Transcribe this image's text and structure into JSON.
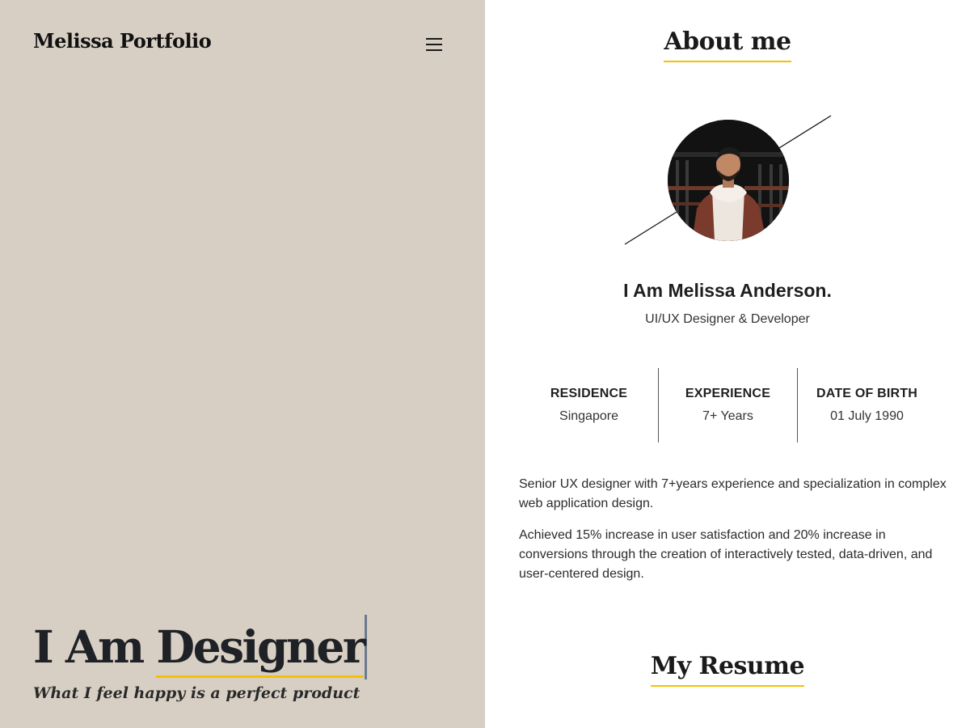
{
  "header": {
    "brand": "Melissa Portfolio",
    "menu_icon": "hamburger-menu-icon"
  },
  "hero": {
    "title_prefix": "I Am ",
    "title_typed": "Designer",
    "subtitle": "What I feel happy is a perfect product"
  },
  "about": {
    "title": "About me",
    "name": "I Am Melissa Anderson.",
    "role": "UI/UX Designer & Developer",
    "stats": [
      {
        "label": "RESIDENCE",
        "value": "Singapore"
      },
      {
        "label": "EXPERIENCE",
        "value": "7+ Years"
      },
      {
        "label": "DATE OF BIRTH",
        "value": "01 July 1990"
      }
    ],
    "bio": [
      "Senior UX designer with 7+years experience and specialization in complex web application design.",
      "Achieved 15% increase in user satisfaction and 20% increase in conversions through the creation of interactively tested, data-driven, and user-centered design."
    ]
  },
  "resume": {
    "title": "My Resume"
  },
  "colors": {
    "left_panel_bg": "#d8cfc4",
    "accent_underline": "#f6c000",
    "caret": "#6b7a8f"
  }
}
